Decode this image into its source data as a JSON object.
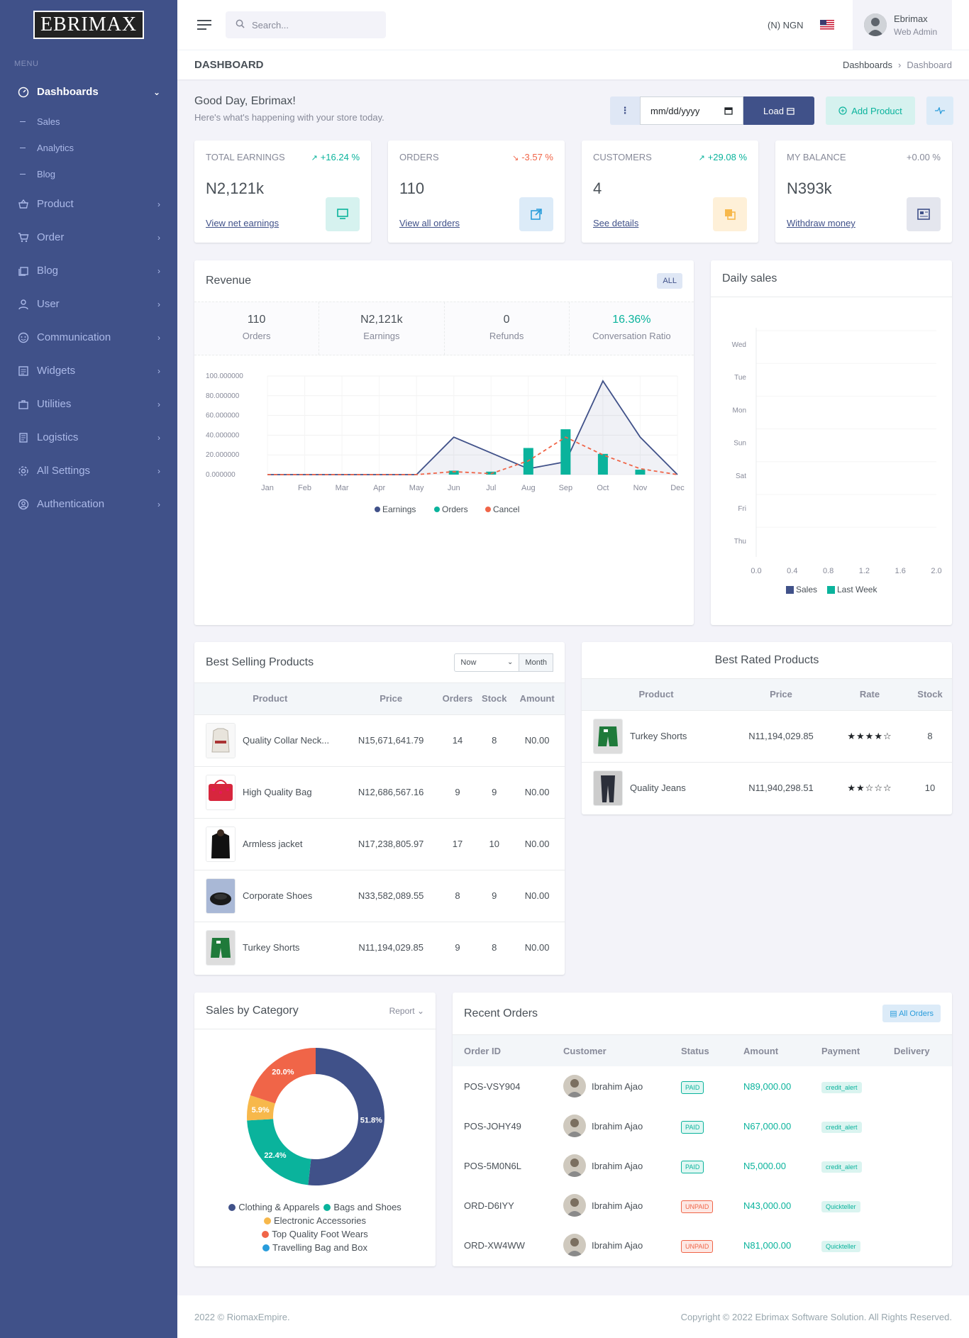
{
  "brand": {
    "name": "BRIMAX",
    "first": "E"
  },
  "sidebar": {
    "menu_title": "MENU",
    "items": [
      {
        "label": "Dashboards",
        "icon": "gauge-icon",
        "active": true
      },
      {
        "label": "Product",
        "icon": "basket-icon"
      },
      {
        "label": "Order",
        "icon": "cart-icon"
      },
      {
        "label": "Blog",
        "icon": "pages-icon"
      },
      {
        "label": "User",
        "icon": "user-icon"
      },
      {
        "label": "Communication",
        "icon": "chat-icon"
      },
      {
        "label": "Widgets",
        "icon": "widgets-icon"
      },
      {
        "label": "Utilities",
        "icon": "briefcase-icon"
      },
      {
        "label": "Logistics",
        "icon": "truck-icon"
      },
      {
        "label": "All Settings",
        "icon": "gear-icon"
      },
      {
        "label": "Authentication",
        "icon": "account-icon"
      }
    ],
    "subitems": [
      "Sales",
      "Analytics",
      "Blog"
    ]
  },
  "topbar": {
    "search_placeholder": "Search...",
    "currency": "(N) NGN",
    "user_name": "Ebrimax",
    "user_role": "Web Admin"
  },
  "pagebar": {
    "title": "DASHBOARD",
    "crumb_root": "Dashboards",
    "crumb_current": "Dashboard"
  },
  "greeting": {
    "title": "Good Day, Ebrimax!",
    "subtitle": "Here's what's happening with your store today."
  },
  "actions": {
    "date_placeholder": "mm/dd/yyyy",
    "load": "Load",
    "add_product": "Add Product"
  },
  "kpis": [
    {
      "title": "TOTAL EARNINGS",
      "change": "+16.24 %",
      "direction": "up",
      "value": "N2,121k",
      "link": "View net earnings",
      "color": "#0ab39c",
      "bg": "#d6f2ef",
      "icon": "monitor-icon"
    },
    {
      "title": "ORDERS",
      "change": "-3.57 %",
      "direction": "down",
      "value": "110",
      "link": "View all orders",
      "color": "#299cdb",
      "bg": "#dcebf8",
      "icon": "external-link-icon"
    },
    {
      "title": "CUSTOMERS",
      "change": "+29.08 %",
      "direction": "up",
      "value": "4",
      "link": "See details",
      "color": "#f7b84b",
      "bg": "#fef0d8",
      "icon": "copy-icon"
    },
    {
      "title": "MY BALANCE",
      "change": "+0.00 %",
      "direction": "flat",
      "value": "N393k",
      "link": "Withdraw money",
      "color": "#405189",
      "bg": "#e4e6ee",
      "icon": "news-icon"
    }
  ],
  "revenue": {
    "title": "Revenue",
    "badge": "ALL",
    "stats": [
      {
        "value": "110",
        "label": "Orders"
      },
      {
        "value": "N2,121k",
        "label": "Earnings"
      },
      {
        "value": "0",
        "label": "Refunds"
      },
      {
        "value": "16.36%",
        "label": "Conversation Ratio"
      }
    ]
  },
  "chart_data": [
    {
      "type": "line",
      "categories": [
        "Jan",
        "Feb",
        "Mar",
        "Apr",
        "May",
        "Jun",
        "Jul",
        "Aug",
        "Sep",
        "Oct",
        "Nov",
        "Dec"
      ],
      "series": [
        {
          "name": "Earnings",
          "kind": "area",
          "color": "#405189",
          "values": [
            0,
            0,
            0,
            0,
            0,
            38,
            22,
            6,
            13,
            95,
            38,
            0
          ]
        },
        {
          "name": "Orders",
          "kind": "bar",
          "color": "#0ab39c",
          "values": [
            0,
            0,
            0,
            0,
            0,
            4,
            3,
            27,
            46,
            21,
            5,
            0
          ]
        },
        {
          "name": "Cancel",
          "kind": "dashed-line",
          "color": "#f06548",
          "values": [
            0,
            0,
            0,
            0,
            0,
            3,
            1,
            14,
            38,
            20,
            6,
            0
          ]
        }
      ],
      "ylim": [
        0,
        100
      ],
      "yticks": [
        "0.000000",
        "20.000000",
        "40.000000",
        "60.000000",
        "80.000000",
        "100.000000"
      ],
      "legend": "bottom"
    },
    {
      "type": "bar",
      "title": "Daily sales",
      "orientation": "horizontal",
      "categories": [
        "Wed",
        "Tue",
        "Mon",
        "Sun",
        "Sat",
        "Fri",
        "Thu"
      ],
      "series": [
        {
          "name": "Sales",
          "color": "#405189",
          "values": [
            0,
            0,
            0,
            0,
            0,
            0,
            0
          ]
        },
        {
          "name": "Last Week",
          "color": "#0ab39c",
          "values": [
            0,
            0,
            0,
            0,
            0,
            0,
            0
          ]
        }
      ],
      "xlim": [
        0,
        2
      ],
      "xticks": [
        "0.0",
        "0.4",
        "0.8",
        "1.2",
        "1.6",
        "2.0"
      ],
      "legend": "bottom"
    },
    {
      "type": "pie",
      "donut": true,
      "labels": [
        "Clothing & Apparels",
        "Bags and Shoes",
        "Electronic Accessories",
        "Top Quality Foot Wears",
        "Travelling Bag and Box"
      ],
      "values": [
        51.8,
        22.4,
        5.9,
        20.0,
        0
      ],
      "value_labels": [
        "51.8%",
        "22.4%",
        "5.9%",
        "20.0%",
        ""
      ],
      "colors": [
        "#405189",
        "#0ab39c",
        "#f7b84b",
        "#f06548",
        "#299cdb"
      ],
      "legend": "bottom"
    }
  ],
  "best_selling": {
    "title": "Best Selling Products",
    "select_value": "Now",
    "month_btn": "Month",
    "columns": [
      "Product",
      "Price",
      "Orders",
      "Stock",
      "Amount"
    ],
    "rows": [
      {
        "name": "Quality Collar Neck...",
        "price": "N15,671,641.79",
        "orders": "14",
        "stock": "8",
        "amount": "N0.00",
        "thumb": "shirt"
      },
      {
        "name": "High Quality Bag",
        "price": "N12,686,567.16",
        "orders": "9",
        "stock": "9",
        "amount": "N0.00",
        "thumb": "bag"
      },
      {
        "name": "Armless jacket",
        "price": "N17,238,805.97",
        "orders": "17",
        "stock": "10",
        "amount": "N0.00",
        "thumb": "jacket"
      },
      {
        "name": "Corporate Shoes",
        "price": "N33,582,089.55",
        "orders": "8",
        "stock": "9",
        "amount": "N0.00",
        "thumb": "shoes"
      },
      {
        "name": "Turkey Shorts",
        "price": "N11,194,029.85",
        "orders": "9",
        "stock": "8",
        "amount": "N0.00",
        "thumb": "shorts"
      }
    ]
  },
  "best_rated": {
    "title": "Best Rated Products",
    "columns": [
      "Product",
      "Price",
      "Rate",
      "Stock"
    ],
    "rows": [
      {
        "name": "Turkey Shorts",
        "price": "N11,194,029.85",
        "rating": 4,
        "stock": "8",
        "thumb": "shorts"
      },
      {
        "name": "Quality Jeans",
        "price": "N11,940,298.51",
        "rating": 2,
        "stock": "10",
        "thumb": "jeans"
      }
    ]
  },
  "sales_by_category": {
    "title": "Sales by Category",
    "report_btn": "Report"
  },
  "recent_orders": {
    "title": "Recent Orders",
    "all_btn": "All Orders",
    "columns": [
      "Order ID",
      "Customer",
      "Status",
      "Amount",
      "Payment",
      "Delivery"
    ],
    "rows": [
      {
        "id": "POS-VSY904",
        "customer": "Ibrahim Ajao",
        "status": "PAID",
        "amount": "N89,000.00",
        "payment": "credit_alert"
      },
      {
        "id": "POS-JOHY49",
        "customer": "Ibrahim Ajao",
        "status": "PAID",
        "amount": "N67,000.00",
        "payment": "credit_alert"
      },
      {
        "id": "POS-5M0N6L",
        "customer": "Ibrahim Ajao",
        "status": "PAID",
        "amount": "N5,000.00",
        "payment": "credit_alert"
      },
      {
        "id": "ORD-D6IYY",
        "customer": "Ibrahim Ajao",
        "status": "UNPAID",
        "amount": "N43,000.00",
        "payment": "Quickteller"
      },
      {
        "id": "ORD-XW4WW",
        "customer": "Ibrahim Ajao",
        "status": "UNPAID",
        "amount": "N81,000.00",
        "payment": "Quickteller"
      }
    ]
  },
  "footer": {
    "left": "2022 © RiomaxEmpire.",
    "right": "Copyright © 2022 Ebrimax Software Solution. All Rights Reserved."
  }
}
